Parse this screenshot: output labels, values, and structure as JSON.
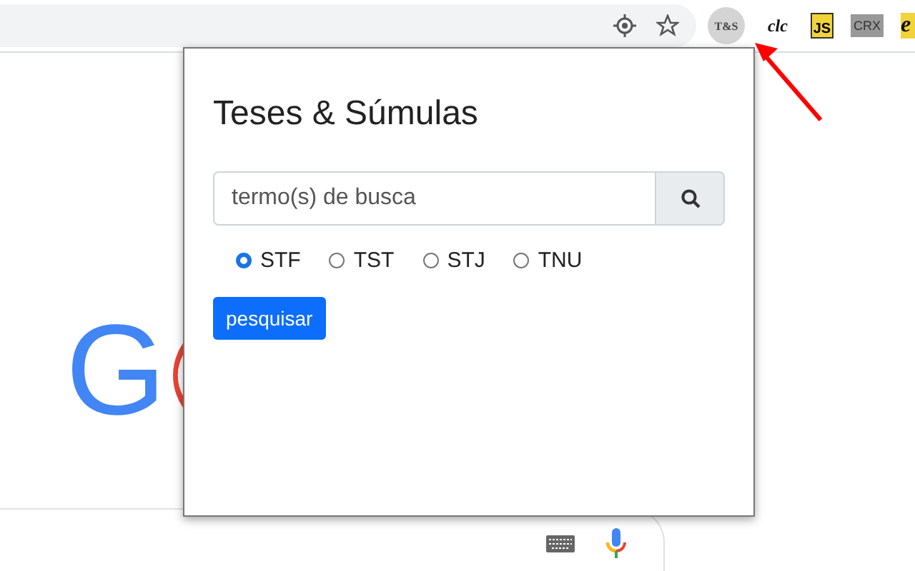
{
  "toolbar": {
    "extensions": [
      {
        "kind": "badge",
        "label": "T&S"
      },
      {
        "kind": "italic",
        "label": "clc"
      },
      {
        "kind": "js",
        "label": "JS"
      },
      {
        "kind": "grey",
        "label": "CRX"
      },
      {
        "kind": "cut",
        "label": "e"
      }
    ]
  },
  "page": {
    "logo": [
      {
        "text": "G",
        "color": "#4285f4"
      }
    ]
  },
  "popup": {
    "title": "Teses & Súmulas",
    "search": {
      "placeholder": "termo(s) de busca"
    },
    "courts": [
      {
        "label": "STF",
        "selected": true
      },
      {
        "label": "TST",
        "selected": false
      },
      {
        "label": "STJ",
        "selected": false
      },
      {
        "label": "TNU",
        "selected": false
      }
    ],
    "button": "pesquisar"
  }
}
